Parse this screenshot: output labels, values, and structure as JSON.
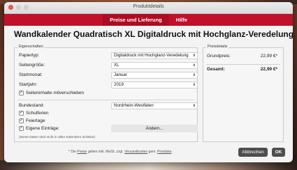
{
  "window": {
    "title": "Produktdetails"
  },
  "tabs": [
    "Preise und Lieferung",
    "Hilfe"
  ],
  "heading": "Wandkalender Quadratisch XL Digitaldruck mit Hochglanz-Veredelung",
  "properties": {
    "section_label": "Eigenschaften",
    "papier_label": "Papiertyp:",
    "papier_value": "Digitaldruck mit Hochglanz-Veredelung",
    "groesse_label": "Seitengröße:",
    "groesse_value": "XL",
    "startmonat_label": "Startmonat:",
    "startmonat_value": "Januar",
    "startjahr_label": "Startjahr:",
    "startjahr_value": "2019",
    "mitverschieben_label": "Seiteninhalte mitverschieben",
    "bundesland_label": "Bundesland:",
    "bundesland_value": "Nordrhein-Westfalen",
    "schulferien_label": "Schulferien",
    "feiertage_label": "Feiertage",
    "eintraege_label": "Eigene Einträge:",
    "aendern_label": "Ändern...",
    "note": "(Diese Daten sind nicht in allen Kalendern sichtbar)"
  },
  "prices": {
    "section_label": "Preisdetails",
    "grundpreis_label": "Grundpreis:",
    "grundpreis_value": "22,99 €*",
    "gesamt_label": "Gesamt:",
    "gesamt_value": "22,99 €*"
  },
  "footer": {
    "note_prefix": "* Die",
    "link_preise": "Preise",
    "note_mid": "gelten inkl. MwSt. zzgl.",
    "link_versand": "Versandkosten",
    "note_mid2": "gem.",
    "link_preisliste": "Preisliste",
    "note_end": ".",
    "cancel_label": "Abbrechen",
    "ok_label": "OK"
  }
}
